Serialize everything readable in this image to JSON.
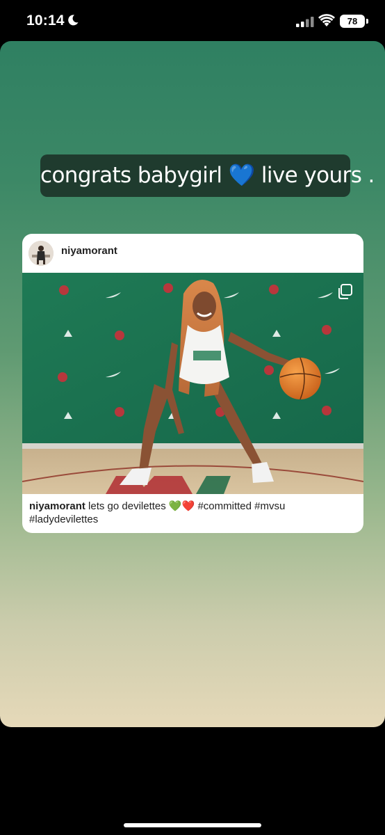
{
  "status_bar": {
    "time": "10:14",
    "battery": "78",
    "icons": [
      "moon-icon",
      "signal-icon",
      "wifi-icon",
      "battery-icon"
    ]
  },
  "story": {
    "caption": "congrats babygirl 💙 live yours .",
    "colors": {
      "background_top": "#2f8062",
      "background_bottom": "#e6d9b9",
      "caption_bubble": "#1f3b2e"
    }
  },
  "shared_post": {
    "username": "niyamorant",
    "caption_user": "niyamorant",
    "caption_text": " lets go devilettes 💚❤️ #committed #mvsu #ladydevilettes",
    "multi_image_icon": "carousel-icon"
  }
}
